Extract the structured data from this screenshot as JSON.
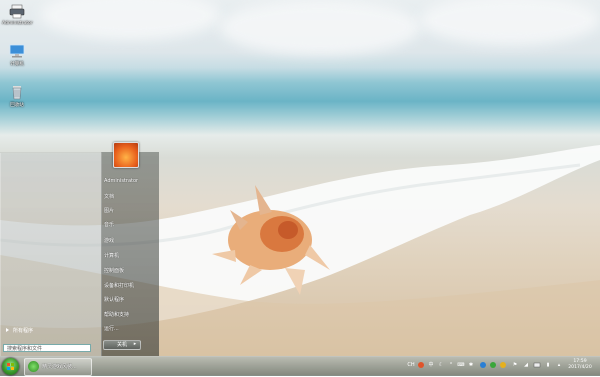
{
  "desktop": {
    "icons": [
      {
        "label": "Administrator",
        "icon": "printer-icon"
      },
      {
        "label": "计算机",
        "icon": "computer-icon"
      },
      {
        "label": "回收站",
        "icon": "recycle-bin-icon"
      }
    ]
  },
  "start_menu": {
    "username": "Administrator",
    "right_links": [
      "文档",
      "图片",
      "音乐",
      "游戏",
      "计算机",
      "控制面板",
      "设备和打印机",
      "默认程序",
      "帮助和支持",
      "运行..."
    ],
    "all_programs": "所有程序",
    "search_placeholder": "搜索程序和文件",
    "shutdown_label": "关机"
  },
  "taskbar": {
    "task_button_label": "精灵游戏风装...",
    "tray": {
      "ime": "CH",
      "icons": [
        "ime-mode-icon",
        "chinese-icon",
        "moon-icon",
        "punctuation-icon",
        "keyboard-icon",
        "settings-icon",
        "security-icon",
        "globe-icon",
        "network-icon",
        "flag-icon",
        "volume-icon",
        "power-icon",
        "action-center-icon",
        "show-hidden-icon"
      ]
    },
    "clock": {
      "time": "17:59",
      "date": "2017/4/20"
    }
  }
}
